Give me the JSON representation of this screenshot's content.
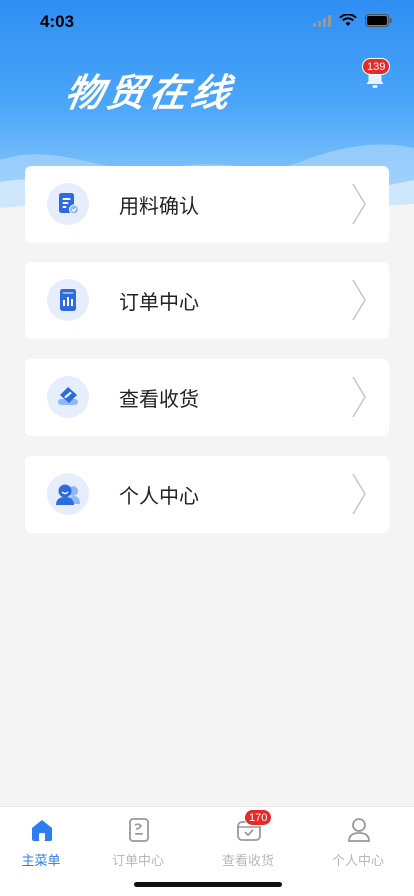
{
  "status": {
    "time": "4:03"
  },
  "header": {
    "title": "物贸在线",
    "notification_count": "139"
  },
  "menu": [
    {
      "label": "用料确认",
      "icon": "document-check-icon"
    },
    {
      "label": "订单中心",
      "icon": "order-report-icon"
    },
    {
      "label": "查看收货",
      "icon": "receive-ticket-icon"
    },
    {
      "label": "个人中心",
      "icon": "users-icon"
    }
  ],
  "tabbar": {
    "items": [
      {
        "label": "主菜单",
        "icon": "home-icon",
        "active": true
      },
      {
        "label": "订单中心",
        "icon": "order-doc-icon"
      },
      {
        "label": "查看收货",
        "icon": "receive-box-icon",
        "badge": "170"
      },
      {
        "label": "个人中心",
        "icon": "person-icon"
      }
    ]
  },
  "colors": {
    "accent": "#2b7df2",
    "badge": "#e62a2a",
    "hero_top": "#2f8ef3"
  }
}
